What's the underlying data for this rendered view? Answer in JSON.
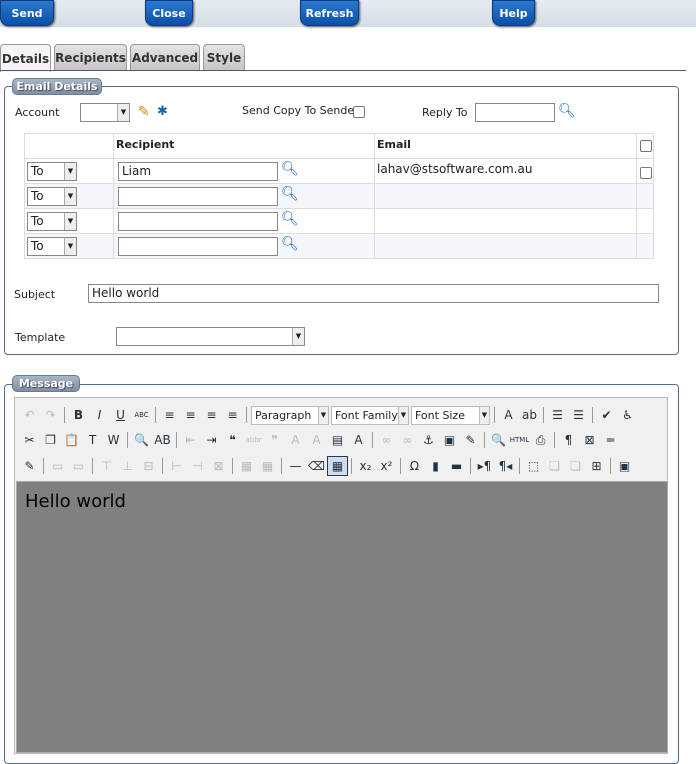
{
  "topbar": {
    "send": "Send",
    "close": "Close",
    "refresh": "Refresh",
    "help": "Help"
  },
  "tabs": [
    "Details",
    "Recipients",
    "Advanced",
    "Style"
  ],
  "active_tab": "Details",
  "email_details": {
    "legend": "Email Details",
    "account_label": "Account",
    "account_value": "",
    "send_copy_label": "Send Copy To Sender",
    "send_copy_checked": false,
    "reply_to_label": "Reply To",
    "reply_to_value": "",
    "headers": {
      "type": "",
      "recipient": "Recipient",
      "email": "Email"
    },
    "rows": [
      {
        "type": "To",
        "recipient": "Liam",
        "email": "lahav@stsoftware.com.au"
      },
      {
        "type": "To",
        "recipient": "",
        "email": ""
      },
      {
        "type": "To",
        "recipient": "",
        "email": ""
      },
      {
        "type": "To",
        "recipient": "",
        "email": ""
      }
    ],
    "subject_label": "Subject",
    "subject_value": "Hello world",
    "template_label": "Template",
    "template_value": ""
  },
  "message": {
    "legend": "Message",
    "format": "Paragraph",
    "font_family": "Font Family",
    "font_size": "Font Size",
    "content": "Hello world",
    "toolbar_rows": [
      [
        [
          "undo-icon",
          "↶",
          1
        ],
        [
          "redo-icon",
          "↷",
          1
        ],
        "|",
        [
          "bold-icon",
          "B"
        ],
        [
          "italic-icon",
          "I"
        ],
        [
          "underline-icon",
          "U"
        ],
        [
          "strikethrough-icon",
          "ABC"
        ],
        "|",
        [
          "align-left-icon",
          "≡"
        ],
        [
          "align-center-icon",
          "≡"
        ],
        [
          "align-right-icon",
          "≡"
        ],
        [
          "align-justify-icon",
          "≡"
        ],
        "|",
        "SELECTS",
        "|",
        [
          "text-color-icon",
          "A"
        ],
        [
          "highlight-color-icon",
          "ab"
        ],
        "|",
        [
          "bullet-list-icon",
          "☰"
        ],
        [
          "numbered-list-icon",
          "☰"
        ],
        "|",
        [
          "spellcheck-icon",
          "✔"
        ],
        [
          "accessibility-icon",
          "♿"
        ]
      ],
      [
        [
          "cut-icon",
          "✂"
        ],
        [
          "copy-icon",
          "❐"
        ],
        [
          "paste-icon",
          "📋"
        ],
        [
          "paste-text-icon",
          "T"
        ],
        [
          "paste-word-icon",
          "W"
        ],
        "|",
        [
          "find-icon",
          "🔍"
        ],
        [
          "replace-icon",
          "AB"
        ],
        "|",
        [
          "outdent-icon",
          "⇤",
          1
        ],
        [
          "indent-icon",
          "⇥"
        ],
        [
          "blockquote-icon",
          "❝"
        ],
        [
          "abbr-icon",
          "abbr",
          1
        ],
        [
          "quote-icon",
          "❞",
          1
        ],
        [
          "del-icon",
          "A",
          1
        ],
        [
          "ins-icon",
          "A",
          1
        ],
        [
          "attributes-icon",
          "▤"
        ],
        [
          "styles-icon",
          "A"
        ],
        "|",
        [
          "link-icon",
          "∞",
          1
        ],
        [
          "unlink-icon",
          "∞",
          1
        ],
        [
          "anchor-icon",
          "⚓"
        ],
        [
          "image-icon",
          "▣"
        ],
        [
          "cleanup-icon",
          "✎"
        ],
        "|",
        [
          "preview-icon",
          "🔍"
        ],
        [
          "html-icon",
          "HTML"
        ],
        [
          "print-icon",
          "⎙"
        ],
        "|",
        [
          "show-blocks-icon",
          "¶"
        ],
        [
          "nonbreaking-icon",
          "⊠"
        ],
        [
          "page-break-icon",
          "═"
        ]
      ],
      [
        [
          "edit-css-icon",
          "✎"
        ],
        "|",
        [
          "row-props-icon",
          "▭",
          1
        ],
        [
          "cell-props-icon",
          "▭",
          1
        ],
        "|",
        [
          "insert-row-before-icon",
          "⊤",
          1
        ],
        [
          "insert-row-after-icon",
          "⊥",
          1
        ],
        [
          "delete-row-icon",
          "⊟",
          1
        ],
        "|",
        [
          "insert-col-before-icon",
          "⊢",
          1
        ],
        [
          "insert-col-after-icon",
          "⊣",
          1
        ],
        [
          "delete-col-icon",
          "⊠",
          1
        ],
        "|",
        [
          "split-cells-icon",
          "▦",
          1
        ],
        [
          "merge-cells-icon",
          "▦",
          1
        ],
        "|",
        [
          "hr-icon",
          "—"
        ],
        [
          "eraser-icon",
          "⌫"
        ],
        [
          "table-icon",
          "▦",
          2
        ],
        "|",
        [
          "subscript-icon",
          "x₂"
        ],
        [
          "superscript-icon",
          "x²"
        ],
        "|",
        [
          "special-char-icon",
          "Ω"
        ],
        [
          "media-icon",
          "▮"
        ],
        [
          "advanced-hr-icon",
          "▬"
        ],
        "|",
        [
          "ltr-icon",
          "▸¶"
        ],
        [
          "rtl-icon",
          "¶◂"
        ],
        "|",
        [
          "visual-aid-icon",
          "⬚"
        ],
        [
          "layer-back-icon",
          "❏",
          1
        ],
        [
          "layer-front-icon",
          "❏",
          1
        ],
        [
          "insert-layer-icon",
          "⊞"
        ],
        "|",
        [
          "fullscreen-icon",
          "▣"
        ]
      ]
    ]
  }
}
